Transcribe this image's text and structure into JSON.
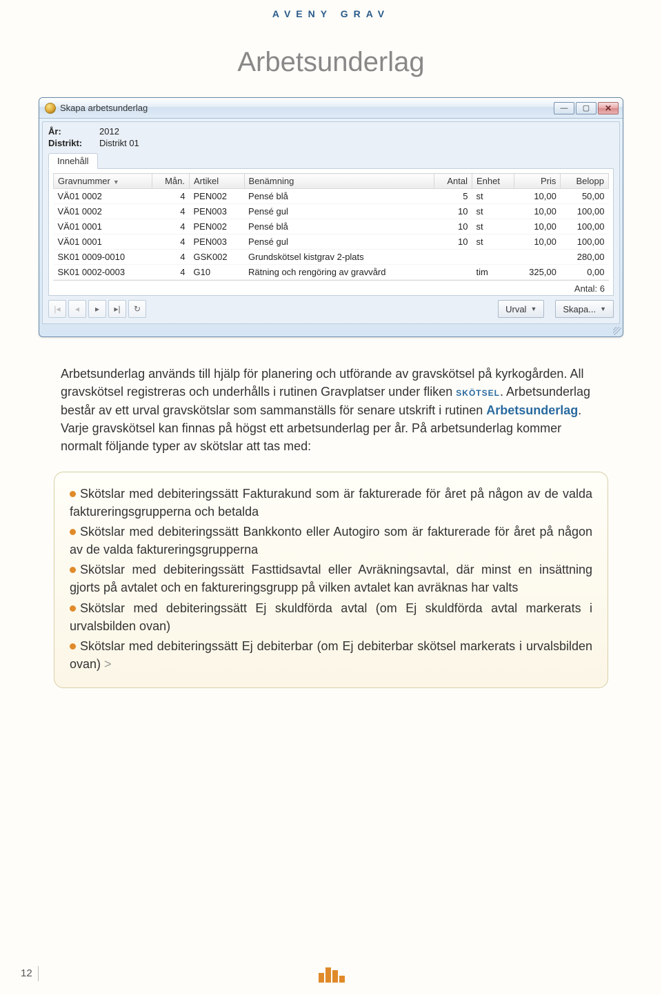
{
  "header": "AVENY GRAV",
  "page_title": "Arbetsunderlag",
  "page_number": "12",
  "window": {
    "title": "Skapa arbetsunderlag",
    "meta": {
      "year_label": "År:",
      "year_value": "2012",
      "district_label": "Distrikt:",
      "district_value": "Distrikt 01"
    },
    "tab_label": "Innehåll",
    "columns": {
      "gravnummer": "Gravnummer",
      "man": "Mån.",
      "artikel": "Artikel",
      "benamning": "Benämning",
      "antal": "Antal",
      "enhet": "Enhet",
      "pris": "Pris",
      "belopp": "Belopp"
    },
    "rows": [
      {
        "gravnummer": "VÄ01 0002",
        "man": "4",
        "artikel": "PEN002",
        "benamning": "Pensé blå",
        "antal": "5",
        "enhet": "st",
        "pris": "10,00",
        "belopp": "50,00"
      },
      {
        "gravnummer": "VÄ01 0002",
        "man": "4",
        "artikel": "PEN003",
        "benamning": "Pensé gul",
        "antal": "10",
        "enhet": "st",
        "pris": "10,00",
        "belopp": "100,00"
      },
      {
        "gravnummer": "VÄ01 0001",
        "man": "4",
        "artikel": "PEN002",
        "benamning": "Pensé blå",
        "antal": "10",
        "enhet": "st",
        "pris": "10,00",
        "belopp": "100,00"
      },
      {
        "gravnummer": "VÄ01 0001",
        "man": "4",
        "artikel": "PEN003",
        "benamning": "Pensé gul",
        "antal": "10",
        "enhet": "st",
        "pris": "10,00",
        "belopp": "100,00"
      },
      {
        "gravnummer": "SK01 0009-0010",
        "man": "4",
        "artikel": "GSK002",
        "benamning": "Grundskötsel kistgrav 2-plats",
        "antal": "",
        "enhet": "",
        "pris": "",
        "belopp": "280,00"
      },
      {
        "gravnummer": "SK01 0002-0003",
        "man": "4",
        "artikel": "G10",
        "benamning": "Rätning och rengöring av gravvård",
        "antal": "",
        "enhet": "tim",
        "pris": "325,00",
        "belopp": "0,00"
      }
    ],
    "footer_count_label": "Antal: 6",
    "buttons": {
      "urval": "Urval",
      "skapa": "Skapa..."
    }
  },
  "body": {
    "p1a": "Arbetsunderlag används till hjälp för planering och utförande av gravskötsel på kyrkogården. All gravskötsel registreras och underhålls i rutinen Gravplatser under fliken ",
    "p1_kw1": "skötsel",
    "p1b": ". Arbetsunderlag består av ett urval gravskötslar som sammanställs för senare utskrift i rutinen ",
    "p1_kw2": "Arbetsunderlag",
    "p1c": ". Varje gravskötsel kan finnas på högst ett arbetsunderlag per år. På arbetsunderlag kommer normalt följande typer av skötslar att tas med:"
  },
  "bullets": {
    "b1": "Skötslar med debiteringssätt Fakturakund som är fakturerade för året på någon av de valda faktureringsgrupperna och betalda",
    "b2": "Skötslar med debiteringssätt Bankkonto eller Autogiro som är fakturerade för året på någon av de valda faktureringsgrupperna",
    "b3": "Skötslar med debiteringssätt Fasttidsavtal eller Avräkningsavtal, där minst en insättning gjorts på avtalet och en faktureringsgrupp på vilken avtalet kan avräknas har valts",
    "b4": "Skötslar med debiteringssätt Ej skuldförda avtal (om Ej skuldförda avtal markerats i urvalsbilden ovan)",
    "b5": "Skötslar med debiteringssätt Ej debiterbar (om Ej debiterbar skötsel markerats i urvalsbilden ovan) "
  }
}
